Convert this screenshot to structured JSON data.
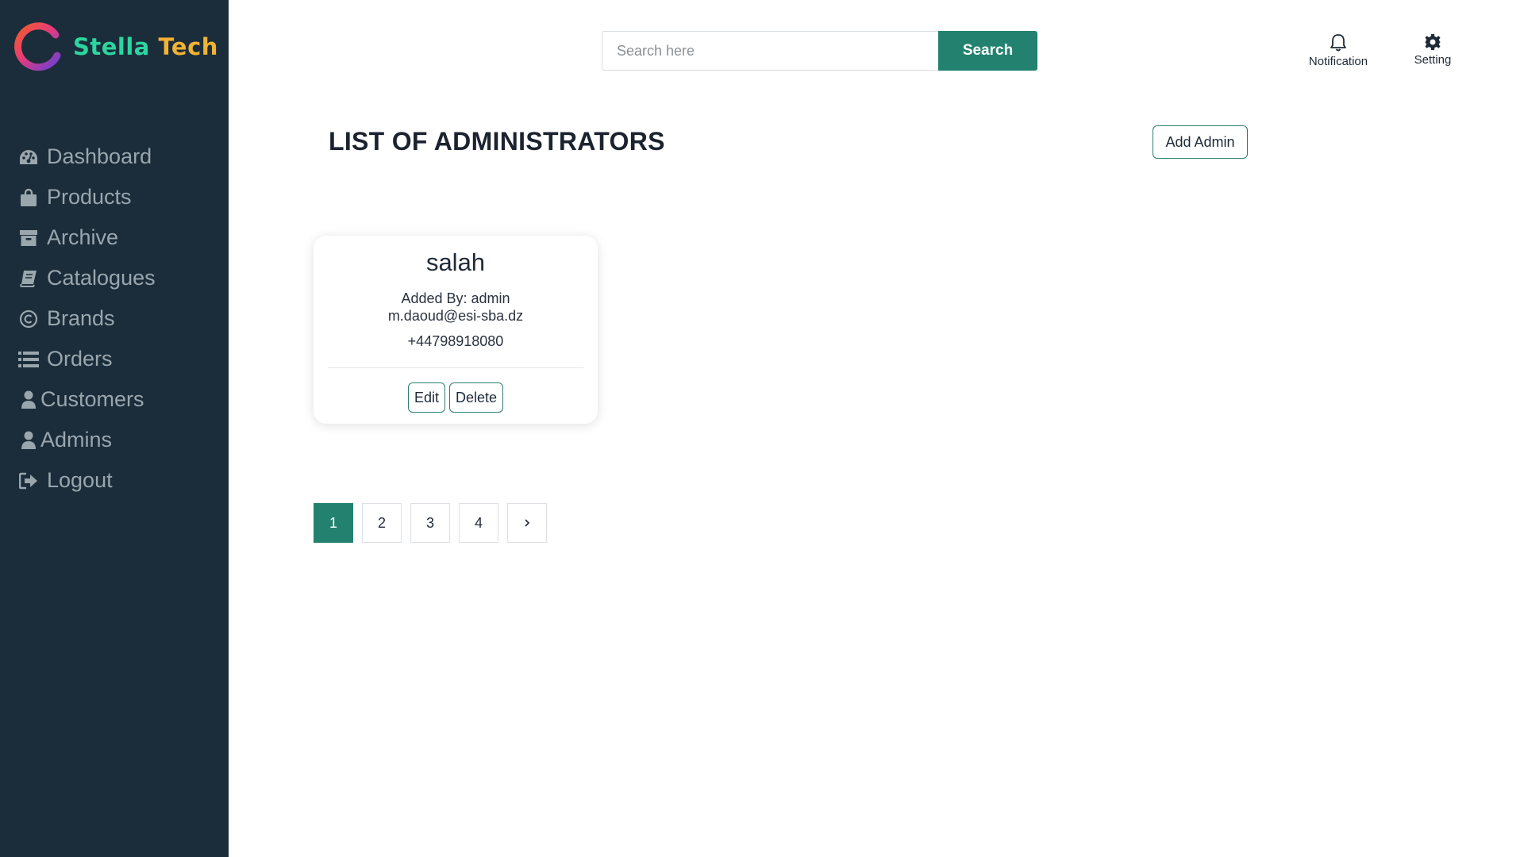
{
  "brand": {
    "name_part1": "Stella",
    "name_part2": "Tech"
  },
  "sidebar": {
    "items": [
      {
        "label": "Dashboard",
        "icon": "dashboard-icon"
      },
      {
        "label": "Products",
        "icon": "shopping-bag-icon"
      },
      {
        "label": "Archive",
        "icon": "archive-icon"
      },
      {
        "label": "Catalogues",
        "icon": "book-icon"
      },
      {
        "label": "Brands",
        "icon": "copyright-icon"
      },
      {
        "label": "Orders",
        "icon": "list-icon"
      },
      {
        "label": "Customers",
        "icon": "user-icon"
      },
      {
        "label": "Admins",
        "icon": "user-icon"
      },
      {
        "label": "Logout",
        "icon": "logout-icon"
      }
    ]
  },
  "header": {
    "search_placeholder": "Search here",
    "search_value": "",
    "search_button": "Search",
    "notification_label": "Notification",
    "setting_label": "Setting"
  },
  "main": {
    "title": "LIST OF ADMINISTRATORS",
    "add_button": "Add Admin",
    "admins": [
      {
        "name": "salah",
        "added_by": "Added By: admin",
        "email": "m.daoud@esi-sba.dz",
        "phone": "+44798918080",
        "edit_label": "Edit",
        "delete_label": "Delete"
      }
    ],
    "pagination": {
      "pages": [
        "1",
        "2",
        "3",
        "4"
      ],
      "current": "1",
      "next_label": "›"
    }
  },
  "colors": {
    "sidebar_bg": "#1b2d3a",
    "accent": "#23816f",
    "nav_text": "#9aa6ae"
  }
}
